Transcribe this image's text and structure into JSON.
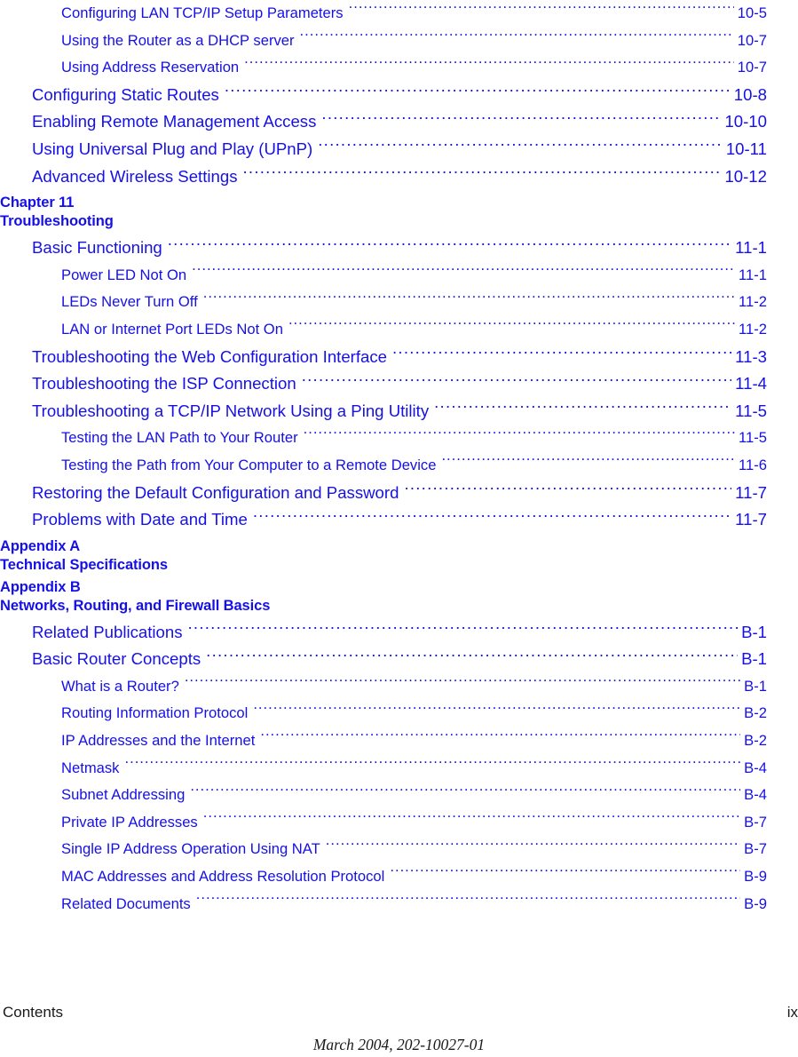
{
  "document": {
    "footer_left": "Contents",
    "footer_page_number": "ix",
    "footer_date_line": "March 2004, 202-10027-01",
    "text_color": "#1510e8",
    "footer_text_color": "#1a1a1a"
  },
  "toc": {
    "blocks": [
      {
        "kind": "entries",
        "entries": [
          {
            "level": 2,
            "title": "Configuring LAN TCP/IP Setup Parameters",
            "page": "10-5"
          },
          {
            "level": 2,
            "title": "Using the Router as a DHCP server",
            "page": "10-7"
          },
          {
            "level": 2,
            "title": "Using Address Reservation",
            "page": "10-7"
          },
          {
            "level": 1,
            "title": "Configuring Static Routes",
            "page": "10-8"
          },
          {
            "level": 1,
            "title": "Enabling Remote Management Access",
            "page": "10-10"
          },
          {
            "level": 1,
            "title": "Using Universal Plug and Play (UPnP)",
            "page": "10-11"
          },
          {
            "level": 1,
            "title": "Advanced Wireless Settings",
            "page": "10-12"
          }
        ]
      },
      {
        "kind": "heading",
        "line1": "Chapter 11",
        "line2": "Troubleshooting"
      },
      {
        "kind": "entries",
        "entries": [
          {
            "level": 1,
            "title": "Basic Functioning",
            "page": "11-1"
          },
          {
            "level": 2,
            "title": "Power LED Not On",
            "page": "11-1"
          },
          {
            "level": 2,
            "title": "LEDs Never Turn Off",
            "page": "11-2"
          },
          {
            "level": 2,
            "title": "LAN or Internet Port LEDs Not On",
            "page": "11-2"
          },
          {
            "level": 1,
            "title": "Troubleshooting the Web Configuration Interface",
            "page": "11-3"
          },
          {
            "level": 1,
            "title": "Troubleshooting the ISP Connection",
            "page": "11-4"
          },
          {
            "level": 1,
            "title": "Troubleshooting a TCP/IP Network Using a Ping Utility",
            "page": "11-5"
          },
          {
            "level": 2,
            "title": "Testing the LAN Path to Your Router",
            "page": "11-5"
          },
          {
            "level": 2,
            "title": "Testing the Path from Your Computer to a Remote Device",
            "page": "11-6"
          },
          {
            "level": 1,
            "title": "Restoring the Default Configuration and Password",
            "page": "11-7"
          },
          {
            "level": 1,
            "title": "Problems with Date and Time",
            "page": "11-7"
          }
        ]
      },
      {
        "kind": "heading",
        "line1": "Appendix A",
        "line2": "Technical Specifications"
      },
      {
        "kind": "heading",
        "line1": "Appendix B",
        "line2": "Networks, Routing, and Firewall Basics"
      },
      {
        "kind": "entries",
        "entries": [
          {
            "level": 1,
            "title": "Related Publications",
            "page": "B-1"
          },
          {
            "level": 1,
            "title": "Basic Router Concepts",
            "page": "B-1"
          },
          {
            "level": 2,
            "title": "What is a Router?",
            "page": "B-1"
          },
          {
            "level": 2,
            "title": "Routing Information Protocol",
            "page": "B-2"
          },
          {
            "level": 2,
            "title": "IP Addresses and the Internet",
            "page": "B-2"
          },
          {
            "level": 2,
            "title": "Netmask",
            "page": "B-4"
          },
          {
            "level": 2,
            "title": "Subnet Addressing",
            "page": "B-4"
          },
          {
            "level": 2,
            "title": "Private IP Addresses",
            "page": "B-7"
          },
          {
            "level": 2,
            "title": "Single IP Address Operation Using NAT",
            "page": "B-7"
          },
          {
            "level": 2,
            "title": "MAC Addresses and Address Resolution Protocol",
            "page": "B-9"
          },
          {
            "level": 2,
            "title": "Related Documents",
            "page": "B-9"
          }
        ]
      }
    ]
  }
}
